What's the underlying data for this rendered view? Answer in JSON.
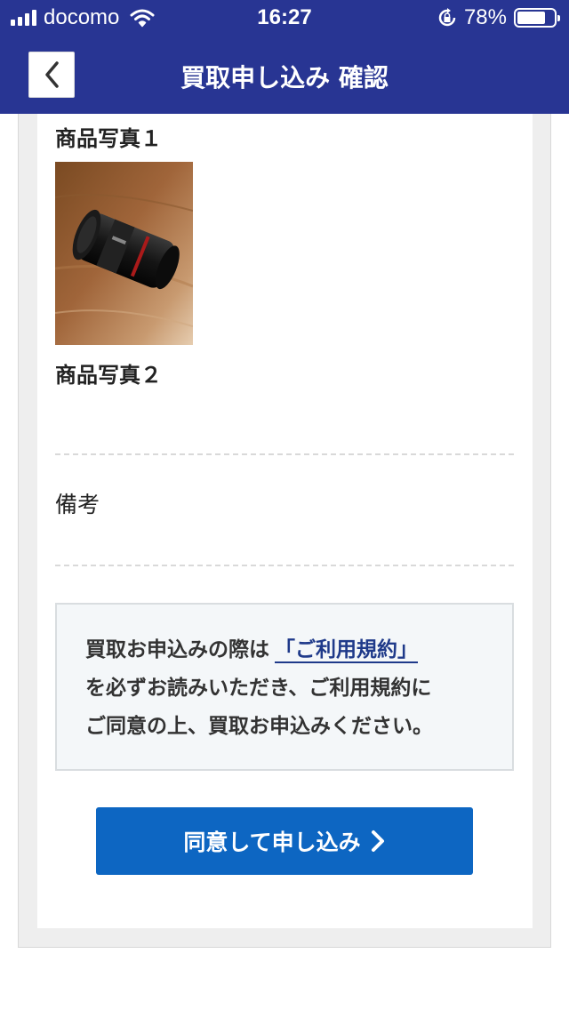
{
  "colors": {
    "header_bg": "#283593",
    "button_bg": "#0d66c2",
    "link": "#1f3a8a"
  },
  "status_bar": {
    "carrier": "docomo",
    "time": "16:27",
    "battery": "78%",
    "battery_level": 0.78
  },
  "header": {
    "title": "買取申し込み 確認",
    "back_icon": "chevron-left-icon"
  },
  "form": {
    "photo1_label": "商品写真１",
    "photo2_label": "商品写真２",
    "remarks_label": "備考"
  },
  "notice": {
    "text_before_link": "買取お申込みの際は",
    "link_text": "「ご利用規約」",
    "line2": "を必ずお読みいただき、ご利用規約に",
    "line3": "ご同意の上、買取お申込みください。"
  },
  "submit": {
    "label": "同意して申し込み",
    "icon": "chevron-right-icon"
  }
}
